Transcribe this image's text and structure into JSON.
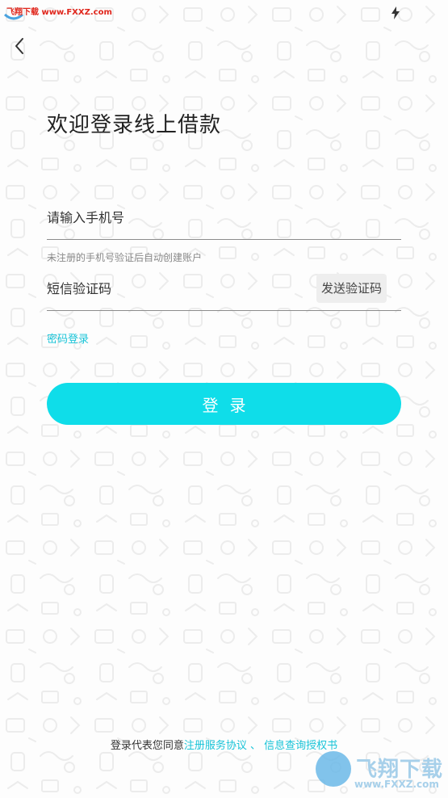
{
  "watermark": {
    "top_text": "飞翔下载 www.FXXZ.com",
    "bottom_brand": "飞翔下载",
    "bottom_url": "www.FXXZ.com"
  },
  "status_bar": {
    "icon": "flash-icon"
  },
  "header": {
    "back_icon": "chevron-left-icon"
  },
  "login": {
    "title": "欢迎登录线上借款",
    "phone_placeholder": "请输入手机号",
    "hint": "未注册的手机号验证后自动创建账户",
    "code_placeholder": "短信验证码",
    "send_code_label": "发送验证码",
    "password_login_link": "密码登录",
    "submit_label": "登录"
  },
  "agreement": {
    "prefix": "登录代表您同意",
    "service_link": "注册服务协议",
    "separator": "、",
    "info_link": "信息查询授权书"
  },
  "colors": {
    "accent": "#0fdde9",
    "link": "#19c4d8",
    "title": "#222222",
    "hint": "#8a8a8a"
  }
}
